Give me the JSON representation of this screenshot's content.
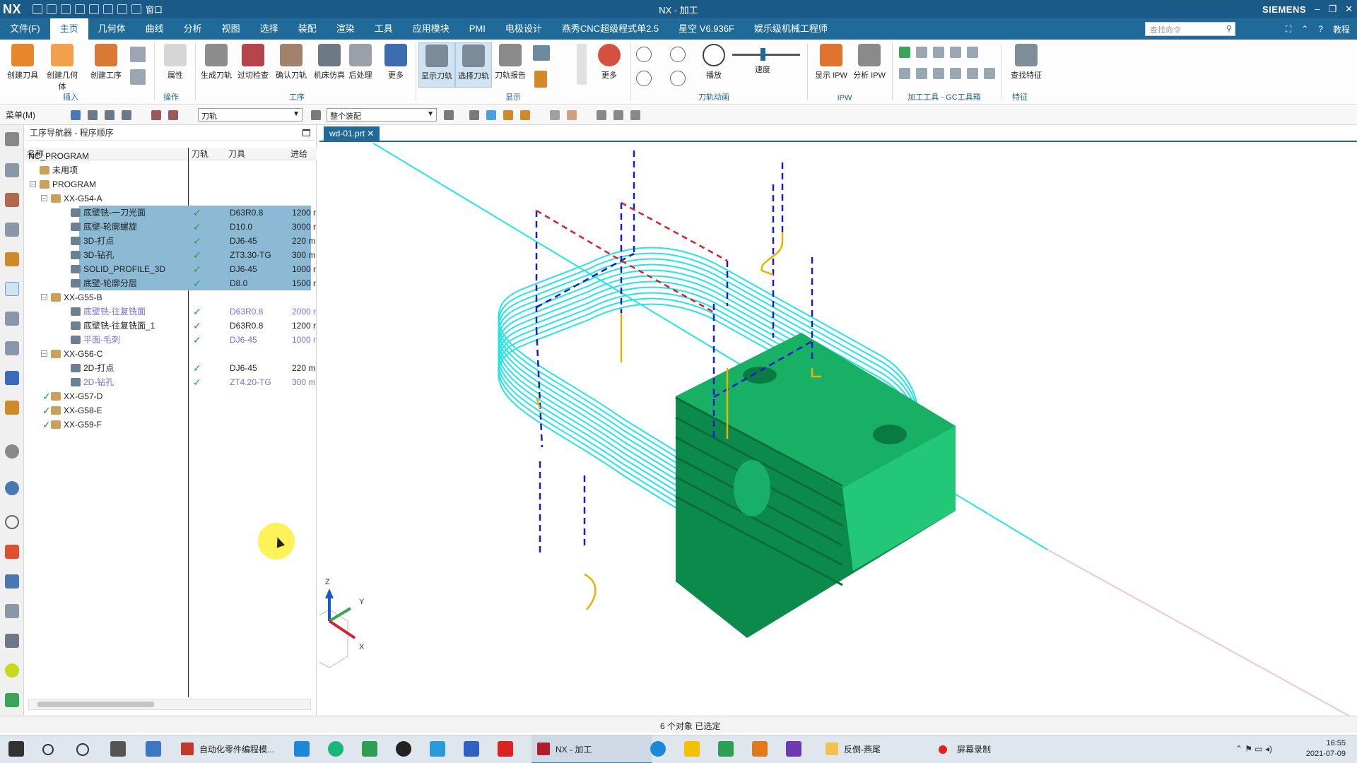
{
  "titlebar": {
    "logo": "NX",
    "window_menu": "窗口",
    "title": "NX - 加工",
    "brand": "SIEMENS",
    "controls": [
      "–",
      "❐",
      "✕"
    ]
  },
  "menubar": {
    "items": [
      "文件(F)",
      "主页",
      "几何体",
      "曲线",
      "分析",
      "视图",
      "选择",
      "装配",
      "渲染",
      "工具",
      "应用模块",
      "PMI",
      "电极设计",
      "燕秀CNC超级程式单2.5",
      "星空 V6.936F",
      "娱乐级机械工程师"
    ],
    "active_index": 1,
    "search_placeholder": "查找命令",
    "help_label": "教程"
  },
  "ribbon": {
    "groups": [
      {
        "label": "插入",
        "buttons": [
          "创建刀具",
          "创建几何体",
          "创建工序"
        ]
      },
      {
        "label": "操作",
        "buttons": [
          "属性"
        ]
      },
      {
        "label": "工序",
        "buttons": [
          "生成刀轨",
          "过切检查",
          "确认刀轨",
          "机床仿真",
          "后处理",
          "更多"
        ]
      },
      {
        "label": "显示",
        "buttons": [
          "显示刀轨",
          "选择刀轨",
          "刀轨报告",
          "更多"
        ]
      },
      {
        "label": "刀轨动画",
        "buttons": [
          "播放",
          "速度"
        ]
      },
      {
        "label": "IPW",
        "buttons": [
          "显示 IPW",
          "分析 IPW"
        ]
      },
      {
        "label": "加工工具 - GC工具箱",
        "buttons": []
      },
      {
        "label": "特征",
        "buttons": [
          "查找特征"
        ]
      }
    ]
  },
  "toolbar2": {
    "menu_label": "菜单(M)",
    "filter_value": "刀轨",
    "scope_value": "整个装配"
  },
  "navigator": {
    "title": "工序导航器 - 程序顺序",
    "columns": [
      "名称",
      "刀轨",
      "刀具",
      "进给"
    ],
    "rows": [
      {
        "name": "NC_PROGRAM",
        "level": 0,
        "check": "",
        "tool": "",
        "feed": ""
      },
      {
        "name": "未用项",
        "level": 1,
        "check": "",
        "tool": "",
        "feed": ""
      },
      {
        "name": "PROGRAM",
        "level": 1,
        "check": "",
        "tool": "",
        "feed": ""
      },
      {
        "name": "XX-G54-A",
        "level": 2,
        "check": "",
        "tool": "",
        "feed": ""
      },
      {
        "name": "底壁铣-一刀光面",
        "level": 3,
        "check": "✓",
        "tool": "D63R0.8",
        "feed": "1200 r",
        "selected": true
      },
      {
        "name": "底壁-轮廓螺旋",
        "level": 3,
        "check": "✓",
        "tool": "D10.0",
        "feed": "3000 r",
        "selected": true
      },
      {
        "name": "3D-打点",
        "level": 3,
        "check": "✓",
        "tool": "DJ6-45",
        "feed": "220 m",
        "selected": true
      },
      {
        "name": "3D-钻孔",
        "level": 3,
        "check": "✓",
        "tool": "ZT3.30-TG",
        "feed": "300 m",
        "selected": true
      },
      {
        "name": "SOLID_PROFILE_3D",
        "level": 3,
        "check": "✓",
        "tool": "DJ6-45",
        "feed": "1000 r",
        "selected": true
      },
      {
        "name": "底壁-轮廓分层",
        "level": 3,
        "check": "✓",
        "tool": "D8.0",
        "feed": "1500 r",
        "selected": true
      },
      {
        "name": "XX-G55-B",
        "level": 2,
        "check": "",
        "tool": "",
        "feed": ""
      },
      {
        "name": "底壁铣-往复铣面",
        "level": 3,
        "check": "✓",
        "tool": "D63R0.8",
        "feed": "2000 r",
        "dim": true
      },
      {
        "name": "底壁铣-往复铣面_1",
        "level": 3,
        "check": "✓",
        "tool": "D63R0.8",
        "feed": "1200 r"
      },
      {
        "name": "平面-毛刺",
        "level": 3,
        "check": "✓",
        "tool": "DJ6-45",
        "feed": "1000 r",
        "dim": true
      },
      {
        "name": "XX-G56-C",
        "level": 2,
        "check": "",
        "tool": "",
        "feed": ""
      },
      {
        "name": "2D-打点",
        "level": 3,
        "check": "✓",
        "tool": "DJ6-45",
        "feed": "220 m"
      },
      {
        "name": "2D-钻孔",
        "level": 3,
        "check": "✓",
        "tool": "ZT4.20-TG",
        "feed": "300 m",
        "dim": true
      },
      {
        "name": "XX-G57-D",
        "level": 2,
        "check": "✓",
        "tool": "",
        "feed": "",
        "group_check": true
      },
      {
        "name": "XX-G58-E",
        "level": 2,
        "check": "✓",
        "tool": "",
        "feed": "",
        "group_check": true
      },
      {
        "name": "XX-G59-F",
        "level": 2,
        "check": "✓",
        "tool": "",
        "feed": "",
        "group_check": true
      }
    ]
  },
  "graphics": {
    "tab_label": "wd-01.prt",
    "axis_labels": {
      "z": "Z",
      "y": "Y",
      "x": "X"
    }
  },
  "statusbar": {
    "message": "6 个对象 已选定"
  },
  "taskbar": {
    "apps": [
      {
        "label": "自动化零件编程模...",
        "active": false
      },
      {
        "label": "NX - 加工",
        "active": true
      },
      {
        "label": "反倒-燕尾",
        "active": false
      },
      {
        "label": "屏幕录制",
        "active": false
      }
    ],
    "time": "16:55",
    "date": "2021-07-09"
  },
  "colors": {
    "titlebar": "#1a5a86",
    "menubar": "#1f6a99",
    "selection": "#8cb9d3",
    "toolpath": "#22e5e5",
    "part": "#0fa05a",
    "rapid_blue": "#1a1acd",
    "rapid_red": "#d3242e",
    "engage_yellow": "#e8b300",
    "check_green": "#1aa03b"
  }
}
